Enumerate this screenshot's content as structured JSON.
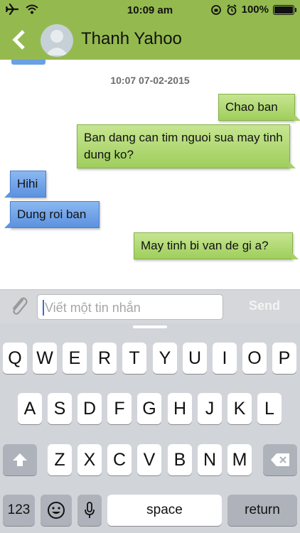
{
  "status_bar": {
    "time": "10:09 am",
    "battery": "100%",
    "icons": [
      "airplane-icon",
      "wifi-icon",
      "orientation-lock-icon",
      "alarm-icon",
      "battery-icon"
    ]
  },
  "header": {
    "title": "Thanh Yahoo",
    "background": "#94ba4f"
  },
  "chat": {
    "date_stamp": "10:07 07-02-2015",
    "messages": [
      {
        "direction": "outgoing",
        "text": "Chao ban"
      },
      {
        "direction": "outgoing",
        "text": "Ban dang can tim nguoi sua may tinh dung ko?"
      },
      {
        "direction": "incoming",
        "text": "Hihi"
      },
      {
        "direction": "incoming",
        "text": "Dung roi ban"
      },
      {
        "direction": "outgoing",
        "text": "May tinh bi van de gi a?"
      }
    ]
  },
  "composer": {
    "placeholder": "Viết một tin nhắn",
    "value": "",
    "send_label": "Send"
  },
  "keyboard": {
    "row1": [
      "Q",
      "W",
      "E",
      "R",
      "T",
      "Y",
      "U",
      "I",
      "O",
      "P"
    ],
    "row2": [
      "A",
      "S",
      "D",
      "F",
      "G",
      "H",
      "J",
      "K",
      "L"
    ],
    "row3": [
      "Z",
      "X",
      "C",
      "V",
      "B",
      "N",
      "M"
    ],
    "numbers_label": "123",
    "space_label": "space",
    "return_label": "return"
  }
}
